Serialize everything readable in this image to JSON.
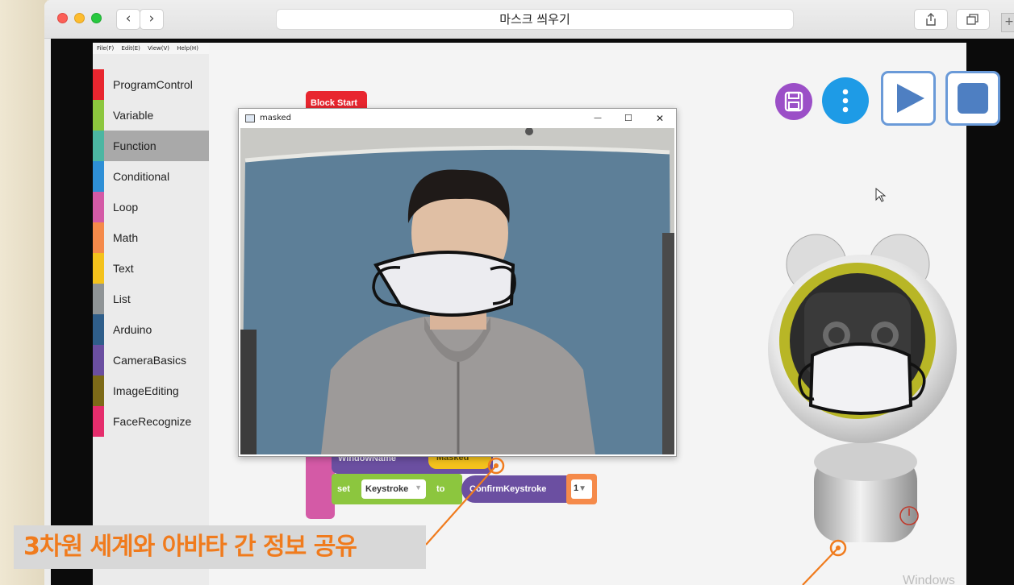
{
  "window": {
    "title": "마스크 씌우기",
    "nav_back": "‹",
    "nav_forward": "›",
    "share_icon": "⇪",
    "tabs_icon": "⧉",
    "plus": "+"
  },
  "menu": {
    "items": [
      "File(F)",
      "Edit(E)",
      "View(V)",
      "Help(H)"
    ]
  },
  "categories": [
    {
      "label": "ProgramControl",
      "color": "#e8262f"
    },
    {
      "label": "Variable",
      "color": "#8cc63e"
    },
    {
      "label": "Function",
      "color": "#4cb6a2",
      "selected": true
    },
    {
      "label": "Conditional",
      "color": "#2e8fd6"
    },
    {
      "label": "Loop",
      "color": "#d45aa6"
    },
    {
      "label": "Math",
      "color": "#f58a4a"
    },
    {
      "label": "Text",
      "color": "#f4c21c"
    },
    {
      "label": "List",
      "color": "#8f9496"
    },
    {
      "label": "Arduino",
      "color": "#2f5e8a"
    },
    {
      "label": "CameraBasics",
      "color": "#6b4fa1"
    },
    {
      "label": "ImageEditing",
      "color": "#7d6a18"
    },
    {
      "label": "FaceRecognize",
      "color": "#e52d6c"
    }
  ],
  "blocks": {
    "block_start": "Block Start",
    "window_name": "WindowName",
    "masked_value": "Masked",
    "set": "set",
    "keystroke": "Keystroke",
    "to": "to",
    "confirm_keystroke": "ConfirmKeystroke",
    "number": "1"
  },
  "toolbar": {
    "save_icon": "floppy-disk",
    "more_icon": "vertical-dots",
    "run_icon": "play",
    "stop_icon": "stop"
  },
  "camera_window": {
    "title": "masked",
    "minimize": "—",
    "maximize": "☐",
    "close": "✕"
  },
  "caption": {
    "text": "3차원 세계와 아바타 간 정보 공유",
    "color": "#f07b1d"
  },
  "watermark": "Windows"
}
